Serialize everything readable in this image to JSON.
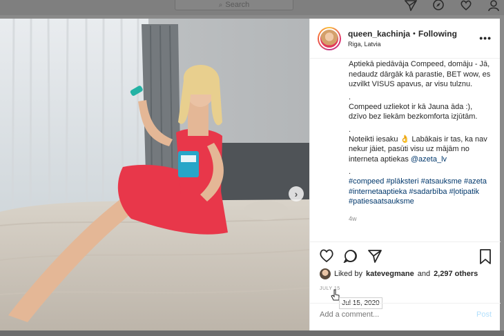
{
  "search": {
    "placeholder": "Search"
  },
  "nav_icons": [
    "send-icon",
    "compass-icon",
    "heart-icon",
    "profile-icon"
  ],
  "post": {
    "username": "queen_kachinja",
    "separator": "•",
    "follow_status": "Following",
    "location": "Riga, Latvia",
    "more_label": "•••",
    "caption_lines": {
      "p1": "Aptiekā piedāvāja Compeed, domāju - Jā, nedaudz dārgāk kā parastie, BET wow, es uzvilkt VISUS apavus, ar visu tulznu.",
      "dot1": ".",
      "p2": "Compeed uzliekot ir kā Jauna āda :), dzīvo bez liekām bezkomforta izjūtām.",
      "dot2": ".",
      "p3_text": "Noteikti iesaku 👌 Labākais ir tas, ka nav nekur jāiet, pasūti visu uz mājām no interneta aptiekas ",
      "p3_mention": "@azeta_lv",
      "dot3": "."
    },
    "hashtags": [
      "#compeed",
      "#plāksteri",
      "#atsauksme",
      "#azeta",
      "#internetaaptieka",
      "#sadarbība",
      "#ļotipatik",
      "#patiesaatsauksme"
    ],
    "time_ago": "4w",
    "liked_by_prefix": "Liked by",
    "liked_by_user": "katevegmane",
    "liked_by_and": "and",
    "liked_by_count": "2,297 others",
    "date_label": "JULY 15",
    "date_tooltip": "Jul 15, 2020",
    "comment_placeholder": "Add a comment...",
    "post_button": "Post"
  },
  "carousel": {
    "next_label": "›",
    "dots": 2,
    "active_dot": 1
  },
  "colors": {
    "link": "#00376b",
    "post_button_disabled": "#b2dffc",
    "dress": "#e8374a",
    "active_dot": "#2d8cf0"
  }
}
